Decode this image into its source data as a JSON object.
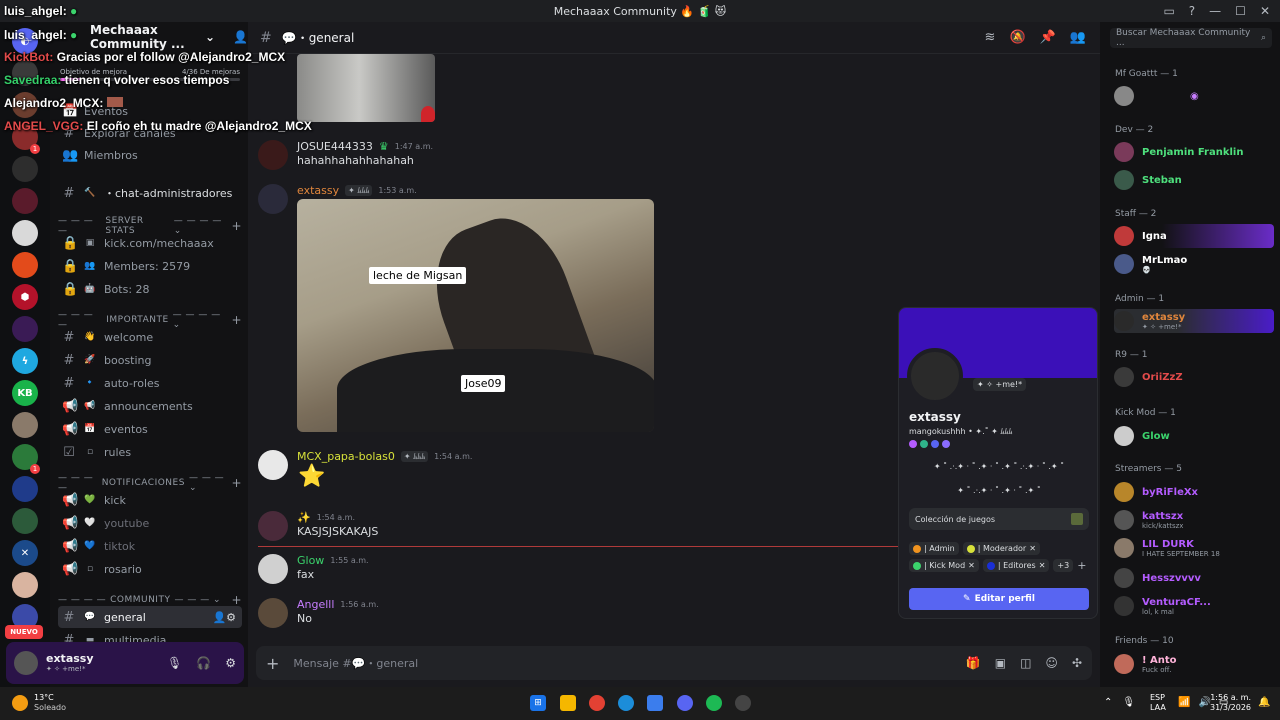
{
  "window": {
    "title": "Mechaaax Community",
    "title_emojis": "🔥 🧃 😻"
  },
  "overlay": {
    "lines": [
      {
        "user": "luis_ahgel:",
        "text": "",
        "color": "#ffffff"
      },
      {
        "user": "luis_ahgel:",
        "text": "",
        "color": "#ffffff"
      },
      {
        "user": "KickBot:",
        "text": "Gracias por el follow @Alejandro2_MCX",
        "color": "#e34b4b"
      },
      {
        "user": "Savedraa:",
        "text": "tienen q volver esos tiempos",
        "color": "#35d06a"
      },
      {
        "user": "Alejandro2_MCX:",
        "text": "",
        "color": "#ffffff"
      },
      {
        "user": "ANGEL_VGG:",
        "text": "El coño eh tu madre @Alejandro2_MCX",
        "color": "#e34b4b"
      }
    ]
  },
  "server": {
    "name": "Mechaaax Community ...",
    "boost_goal": "Objetivo de mejora",
    "boost_progress": "4/36 De mejoras",
    "boost_fraction": 0.11
  },
  "sidebar": {
    "top_items": [
      "Eventos",
      "Explorar canales",
      "Miembros"
    ],
    "admin_channel": "chat-administradores",
    "categories": [
      {
        "name": "SERVER STATS",
        "channels": [
          "kick.com/mechaaax",
          "Members: 2579",
          "Bots: 28"
        ]
      },
      {
        "name": "IMPORTANTE",
        "channels": [
          "welcome",
          "boosting",
          "auto-roles",
          "announcements",
          "eventos",
          "rules"
        ]
      },
      {
        "name": "NOTIFICACIONES",
        "channels": [
          "kick",
          "youtube",
          "tiktok",
          "rosario"
        ]
      },
      {
        "name": "COMMUNITY",
        "channels": [
          "general",
          "multimedia"
        ]
      }
    ],
    "nuevo": "NUEVO"
  },
  "user_panel": {
    "name": "extassy",
    "status": "✦ ✧ +me!*"
  },
  "channel": {
    "name": "general",
    "composer_placeholder": "Mensaje #💬・general"
  },
  "messages": [
    {
      "author": "JOSUE444333",
      "time": "1:47 a.m.",
      "text": "hahahhahahhahahah",
      "color": "#dbdee1"
    },
    {
      "author": "extassy",
      "time": "1:53 a.m.",
      "text": "",
      "color": "#e0863c",
      "tag": "✦ ﾑﾑﾑ"
    },
    {
      "author": "MCX_papa-bolas0",
      "time": "1:54 a.m.",
      "text": "",
      "color": "#d7e13a",
      "tag": "✦ ﾑﾑﾑ"
    },
    {
      "author": "✨",
      "time": "1:54 a.m.",
      "text": "KASJSJSKAKAJS",
      "color": "#dbdee1"
    },
    {
      "author": "Glow",
      "time": "1:55 a.m.",
      "text": "fax",
      "color": "#3bd36c"
    },
    {
      "author": "Angelll",
      "time": "1:56 a.m.",
      "text": "No",
      "color": "#c77dff"
    }
  ],
  "image_captions": {
    "a": "leche de Migsan",
    "b": "Jose09"
  },
  "search": {
    "placeholder": "Buscar Mechaaax Community ..."
  },
  "member_groups": [
    {
      "label": "Mf Goattt — 1",
      "members": [
        {
          "name": "",
          "status": "",
          "color": "#c77dff"
        }
      ]
    },
    {
      "label": "Dev — 2",
      "members": [
        {
          "name": "Penjamin Franklin",
          "status": "",
          "color": "#4ee07d"
        },
        {
          "name": "Steban",
          "status": "",
          "color": "#4ee07d"
        }
      ]
    },
    {
      "label": "Staff — 2",
      "members": [
        {
          "name": "Igna",
          "status": "",
          "color": "#ffffff"
        },
        {
          "name": "MrLmao",
          "status": "💀",
          "color": "#ffffff"
        }
      ]
    },
    {
      "label": "Admin — 1",
      "members": [
        {
          "name": "extassy",
          "status": "✦ ✧ +me!*",
          "color": "#e0863c"
        }
      ]
    },
    {
      "label": "R9 — 1",
      "members": [
        {
          "name": "OriiZzZ",
          "status": "",
          "color": "#e34b4b"
        }
      ]
    },
    {
      "label": "Kick Mod — 1",
      "members": [
        {
          "name": "Glow",
          "status": "",
          "color": "#3bd36c"
        }
      ]
    },
    {
      "label": "Streamers — 5",
      "members": [
        {
          "name": "byRiFleXx",
          "status": "",
          "color": "#b45cff"
        },
        {
          "name": "kattszx",
          "status": "kick/kattszx",
          "color": "#b45cff"
        },
        {
          "name": "LIL DURK",
          "status": "I HATE SEPTEMBER 18",
          "color": "#b45cff"
        },
        {
          "name": "Hesszvvvv",
          "status": "",
          "color": "#b45cff"
        },
        {
          "name": "VenturaCF...",
          "status": "lol, k mal",
          "color": "#b45cff"
        }
      ]
    },
    {
      "label": "Friends — 10",
      "members": [
        {
          "name": "! Anto",
          "status": "Fuck off.",
          "color": "#ffb3d9"
        }
      ]
    }
  ],
  "profile": {
    "name": "extassy",
    "username": "mangokushhh • ✦.˚ ✦ ﾑﾑﾑ",
    "status": "✦ ✧ +me!*",
    "bio_line1": "✦ ˚ .·.✦ · ˚ .✦ · ˚ .✦ ˚ .·.✦ · ˚ .✦ ˚",
    "bio_line2": "✦ ˚ .·.✦ · ˚ .✦ · ˚ .✦ ˚",
    "games_label": "Colección de juegos",
    "roles": [
      {
        "name": "| Admin",
        "color": "#f0931f"
      },
      {
        "name": "| Moderador",
        "color": "#d7e13a"
      },
      {
        "name": "| Kick Mod",
        "color": "#3bd36c"
      },
      {
        "name": "| Editores",
        "color": "#1a2fd6"
      }
    ],
    "roles_more": "+3",
    "edit_button": "Editar perfil"
  },
  "taskbar": {
    "temp": "13°C",
    "weather": "Soleado",
    "lang1": "ESP",
    "lang2": "LAA",
    "time": "1:56 a. m.",
    "date": "31/3/2026"
  }
}
